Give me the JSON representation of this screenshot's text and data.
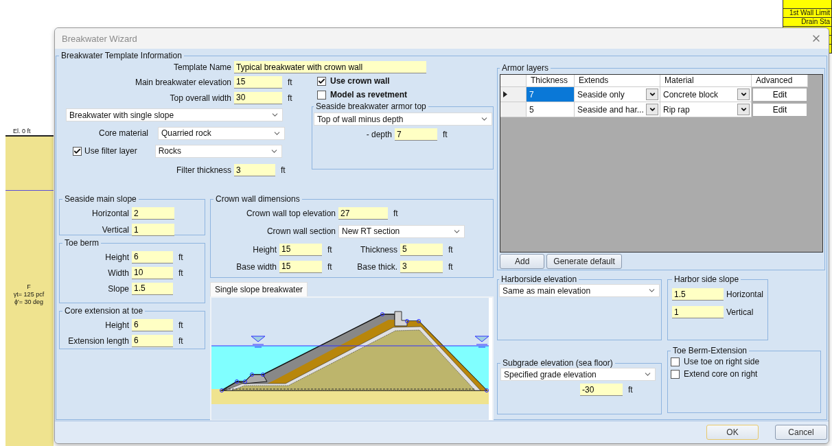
{
  "background": {
    "elevation_label": "El. 0 ft",
    "soil_labels": [
      "F",
      "γt= 125 pcf",
      "ϕ'= 30 deg"
    ],
    "table_cells": [
      "1st Wall Limit",
      "Drain Sta"
    ]
  },
  "dialog": {
    "title": "Breakwater Wizard",
    "template": {
      "title": "Breakwater Template Information",
      "template_name": {
        "label": "Template Name",
        "value": "Typical breakwater with crown wall"
      },
      "fields": [
        {
          "label": "Main breakwater elevation",
          "value": "15",
          "unit": "ft"
        },
        {
          "label": "Top  overall width",
          "value": "30",
          "unit": "ft"
        }
      ],
      "type_select": "Breakwater with single slope",
      "core_material": {
        "label": "Core material",
        "value": "Quarried rock"
      },
      "filter_layer": {
        "label": "Use filter layer",
        "checked": true,
        "value": "Rocks"
      },
      "filter_thickness": {
        "label": "Filter thickness",
        "value": "3",
        "unit": "ft"
      },
      "options": [
        {
          "label": "Use crown wall",
          "checked": true
        },
        {
          "label": "Model as revetment",
          "checked": false
        }
      ],
      "armor_top": {
        "title": "Seaside breakwater armor top",
        "select": "Top of wall minus depth",
        "depth": {
          "label": "- depth",
          "value": "7",
          "unit": "ft"
        }
      },
      "seaside_slope": {
        "title": "Seaside main slope",
        "fields": [
          {
            "label": "Horizontal",
            "value": "2"
          },
          {
            "label": "Vertical",
            "value": "1"
          }
        ]
      },
      "toe_berm": {
        "title": "Toe berm",
        "fields": [
          {
            "label": "Height",
            "value": "6",
            "unit": "ft"
          },
          {
            "label": "Width",
            "value": "10",
            "unit": "ft"
          },
          {
            "label": "Slope",
            "value": "1.5"
          }
        ]
      },
      "core_extension": {
        "title": "Core extension at toe",
        "fields": [
          {
            "label": "Height",
            "value": "6",
            "unit": "ft"
          },
          {
            "label": "Extension length",
            "value": "6",
            "unit": "ft"
          }
        ]
      },
      "crown_wall": {
        "title": "Crown wall dimensions",
        "top_elevation": {
          "label": "Crown wall top elevation",
          "value": "27",
          "unit": "ft"
        },
        "section": {
          "label": "Crown wall section",
          "value": "New RT section"
        },
        "fields": [
          {
            "label": "Height",
            "value": "15",
            "unit": "ft"
          },
          {
            "label": "Thickness",
            "value": "5",
            "unit": "ft"
          },
          {
            "label": "Base width",
            "value": "15",
            "unit": "ft"
          },
          {
            "label": "Base thick.",
            "value": "3",
            "unit": "ft"
          }
        ]
      },
      "diagram": {
        "tab": "Single slope breakwater"
      },
      "armor_layers": {
        "title": "Armor layers",
        "columns": [
          "Thickness",
          "Extends",
          "Material",
          "Advanced"
        ],
        "rows": [
          {
            "selected": true,
            "thickness": "7",
            "extends": "Seaside only",
            "material": "Concrete block",
            "action": "Edit"
          },
          {
            "selected": false,
            "thickness": "5",
            "extends": "Seaside and har...",
            "material": "Rip rap",
            "action": "Edit"
          }
        ],
        "buttons": [
          "Add",
          "Generate default"
        ]
      },
      "harborside_elevation": {
        "title": "Harborside elevation",
        "select": "Same as main elevation"
      },
      "harbor_slope": {
        "title": "Harbor side slope",
        "fields": [
          {
            "label": "Horizontal",
            "value": "1.5"
          },
          {
            "label": "Vertical",
            "value": "1"
          }
        ]
      },
      "subgrade": {
        "title": "Subgrade elevation (sea floor)",
        "select": "Specified grade elevation",
        "value": "-30",
        "unit": "ft"
      },
      "toe_extension": {
        "title": "Toe Berm-Extension",
        "options": [
          {
            "label": "Use toe on right side",
            "checked": false
          },
          {
            "label": "Extend core on right",
            "checked": false
          }
        ]
      }
    },
    "buttons": [
      {
        "label": "OK",
        "default": true
      },
      {
        "label": "Cancel",
        "default": false
      }
    ]
  }
}
